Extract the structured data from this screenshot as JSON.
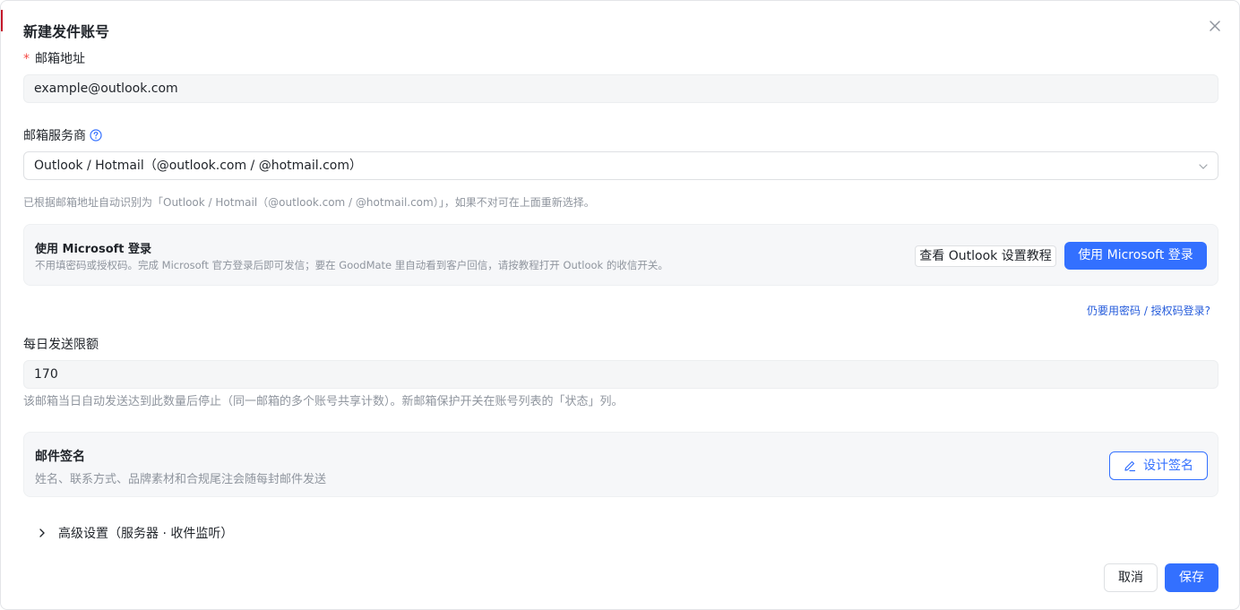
{
  "dialog": {
    "title": "新建发件账号",
    "close_icon": "close-icon"
  },
  "email": {
    "required_mark": "*",
    "label": "邮箱地址",
    "value": "example@outlook.com"
  },
  "provider": {
    "label": "邮箱服务商",
    "help_icon": "question-circle-icon",
    "selected": "Outlook / Hotmail（@outlook.com / @hotmail.com）",
    "hint": "已根据邮箱地址自动识别为「Outlook / Hotmail（@outlook.com / @hotmail.com）」，如果不对可在上面重新选择。"
  },
  "microsoft_card": {
    "title": "使用 Microsoft 登录",
    "desc": "不用填密码或授权码。完成 Microsoft 官方登录后即可发信；要在 GoodMate 里自动看到客户回信，请按教程打开 Outlook 的收信开关。",
    "tutorial_label": "查看 Outlook 设置教程",
    "login_label": "使用 Microsoft 登录",
    "alt_link": "仍要用密码 / 授权码登录?"
  },
  "daily_limit": {
    "label": "每日发送限额",
    "value": "170",
    "hint": "该邮箱当日自动发送达到此数量后停止（同一邮箱的多个账号共享计数）。新邮箱保护开关在账号列表的「状态」列。"
  },
  "signature_card": {
    "title": "邮件签名",
    "desc": "姓名、联系方式、品牌素材和合规尾注会随每封邮件发送",
    "button_label": "设计签名",
    "button_icon": "pen-icon"
  },
  "advanced": {
    "label": "高级设置（服务器 · 收件监听）",
    "icon": "chevron-right-icon"
  },
  "footer": {
    "cancel_label": "取消",
    "save_label": "保存"
  },
  "colors": {
    "primary": "#3370ff",
    "required": "#f54a45",
    "link": "#245bdb",
    "muted_text": "#8f959e"
  }
}
